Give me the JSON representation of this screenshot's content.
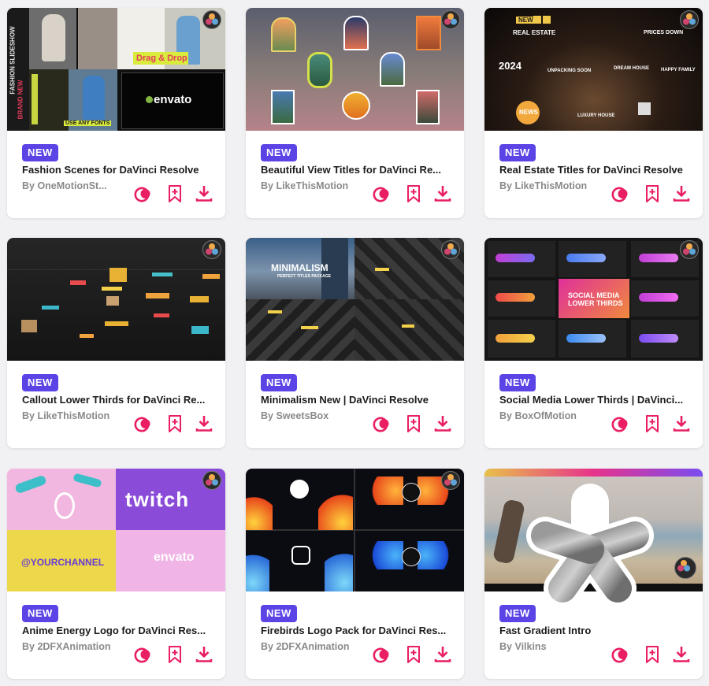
{
  "colors": {
    "accent": "#e91e63",
    "badge": "#5b44e6"
  },
  "cards": [
    {
      "badge": "NEW",
      "title": "Fashion Scenes for DaVinci Resolve",
      "author": "By OneMotionSt...",
      "thumb_text": {
        "a": "FASHION SLIDESHOW",
        "b": "Drag & Drop",
        "c": "BRAND NEW",
        "d": "USE ANY FONTS",
        "e": "envato"
      }
    },
    {
      "badge": "NEW",
      "title": "Beautiful View Titles for DaVinci Re...",
      "author": "By LikeThisMotion"
    },
    {
      "badge": "NEW",
      "title": "Real Estate Titles for DaVinci Resolve",
      "author": "By LikeThisMotion",
      "thumb_text": {
        "a": "NEW",
        "b": "REAL ESTATE",
        "c": "PRICES DOWN",
        "d": "2024",
        "e": "UNPACKING SOON",
        "f": "DREAM HOUSE",
        "g": "HAPPY FAMILY",
        "h": "NEWS",
        "i": "LUXURY HOUSE"
      }
    },
    {
      "badge": "NEW",
      "title": "Callout Lower Thirds for DaVinci Re...",
      "author": "By LikeThisMotion"
    },
    {
      "badge": "NEW",
      "title": "Minimalism New | DaVinci Resolve",
      "author": "By SweetsBox",
      "thumb_text": {
        "a": "MINIMALISM",
        "b": "PERFECT TITLES PACKAGE"
      }
    },
    {
      "badge": "NEW",
      "title": "Social Media Lower Thirds | DaVinci...",
      "author": "By BoxOfMotion",
      "thumb_text": {
        "a": "SOCIAL MEDIA",
        "b": "LOWER THIRDS"
      }
    },
    {
      "badge": "NEW",
      "title": "Anime Energy Logo for DaVinci Res...",
      "author": "By 2DFXAnimation",
      "thumb_text": {
        "a": "twitch",
        "b": "@YOURCHANNEL",
        "c": "envato"
      }
    },
    {
      "badge": "NEW",
      "title": "Firebirds Logo Pack for DaVinci Res...",
      "author": "By 2DFXAnimation"
    },
    {
      "badge": "NEW",
      "title": "Fast Gradient Intro",
      "author": "By Vilkins"
    }
  ]
}
